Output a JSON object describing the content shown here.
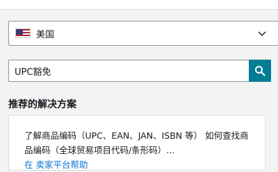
{
  "country_select": {
    "selected": "美国",
    "flag": "us-flag-icon"
  },
  "search": {
    "value": "UPC豁免",
    "icon": "search-icon"
  },
  "recommendations": {
    "title": "推荐的解决方案",
    "items": [
      {
        "text": "了解商品编码（UPC、EAN、JAN、ISBN 等） 如何查找商品编码（全球贸易项目代码/条形码）...",
        "link": "在 卖家平台帮助"
      }
    ]
  },
  "colors": {
    "accent": "#007d94",
    "link": "#0972d3"
  }
}
